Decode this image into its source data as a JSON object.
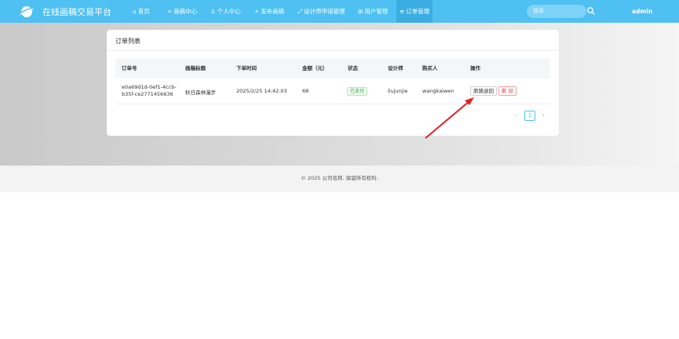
{
  "brand": "在线画稿交易平台",
  "nav": [
    {
      "icon": "⌂",
      "label": "首页"
    },
    {
      "icon": "≈",
      "label": "画稿中心"
    },
    {
      "icon": "♙",
      "label": "个人中心"
    },
    {
      "icon": "+",
      "label": "发布画稿"
    },
    {
      "icon": "⤢",
      "label": "设计师申请管理"
    },
    {
      "icon": "⊞",
      "label": "用户管理"
    },
    {
      "icon": "≡",
      "label": "订单管理"
    }
  ],
  "search_placeholder": "搜索",
  "user": "admin",
  "colors": {
    "nav_bg": "#4ec0f2",
    "active_nav": "#3aaee2",
    "paid": "#3aa548",
    "delete": "#e84a4a",
    "arrow": "#e02020"
  },
  "card_title": "订单列表",
  "columns": [
    "订单号",
    "画稿标题",
    "下单时间",
    "金额（元）",
    "状态",
    "设计师",
    "购买人",
    "操作"
  ],
  "rows": [
    {
      "order_id_line1": "e0a69d1d-0ef1-4ccb-",
      "order_id_line2": "b35f-ce2771456636",
      "title": "秋日森林漫步",
      "time": "2025/2/25 14:42:03",
      "amount": "68",
      "status": "已支付",
      "designer": "liujunjie",
      "buyer": "wangkaiwen",
      "refund_label": "原路退回",
      "delete_label": "删 除"
    }
  ],
  "pagination": {
    "prev": "‹",
    "current": "1",
    "next": "›"
  },
  "footer": "© 2025 公司名称. 保留所有权利."
}
